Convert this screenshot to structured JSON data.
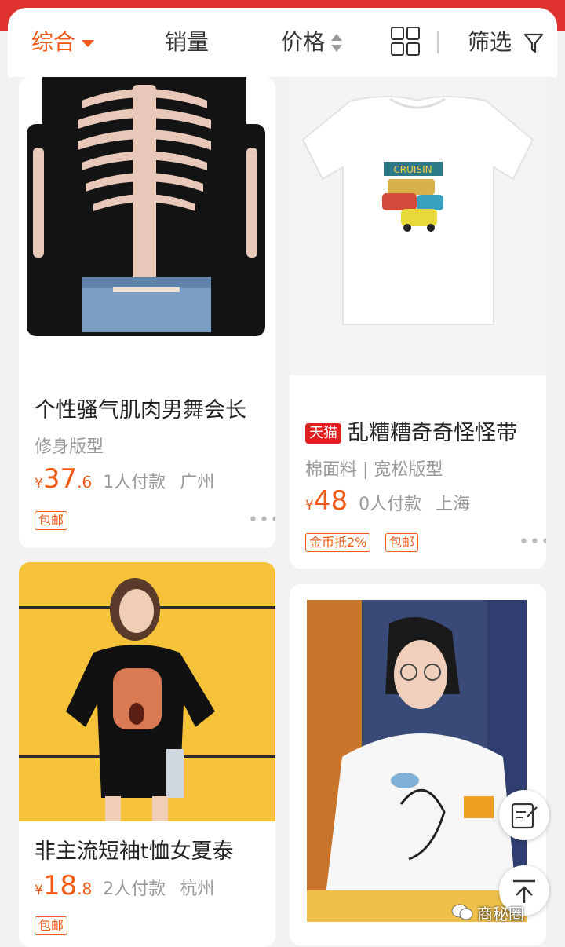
{
  "sort_bar": {
    "comprehensive": "综合",
    "sales": "销量",
    "price": "价格",
    "filter": "筛选",
    "colors": {
      "active": "#f05a14",
      "brand_red": "#e0322e"
    }
  },
  "products": [
    {
      "title": "个性骚气肌肉男舞会长",
      "attrs": "修身版型",
      "currency": "¥",
      "price_int": "37",
      "price_dec": ".6",
      "sales": "1人付款",
      "location": "广州",
      "tags": [
        "包邮"
      ],
      "more": "•••"
    },
    {
      "badge": "天猫",
      "title": "乱糟糟奇奇怪怪带",
      "attrs": "棉面料 | 宽松版型",
      "currency": "¥",
      "price_int": "48",
      "price_dec": "",
      "sales": "0人付款",
      "location": "上海",
      "tags": [
        "金币抵2%",
        "包邮"
      ],
      "more": "•••"
    },
    {
      "title": "非主流短袖t恤女夏泰",
      "attrs": "",
      "currency": "¥",
      "price_int": "18",
      "price_dec": ".8",
      "sales": "2人付款",
      "location": "杭州",
      "tags": [
        "包邮"
      ]
    },
    {
      "title": "",
      "image_text": "CRUISIN"
    }
  ],
  "image_texts": {
    "tshirt_print": "CRUISIN"
  },
  "watermark": "商秘圈",
  "icons": [
    "chevron-down-icon",
    "sort-updown-icon",
    "grid-view-icon",
    "filter-funnel-icon",
    "edit-note-icon",
    "back-to-top-icon",
    "wechat-icon",
    "more-dots-icon"
  ]
}
